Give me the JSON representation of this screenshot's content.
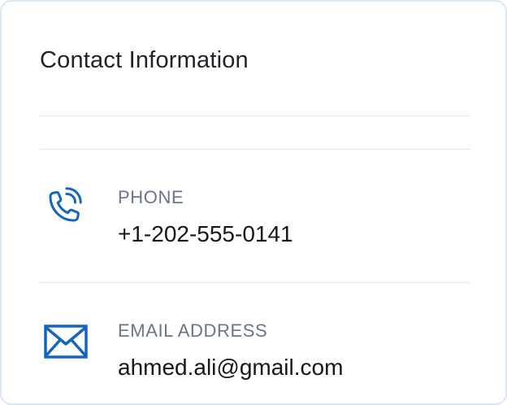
{
  "card": {
    "title": "Contact Information"
  },
  "contacts": [
    {
      "icon": "phone-icon",
      "label": "PHONE",
      "value": "+1-202-555-0141"
    },
    {
      "icon": "mail-icon",
      "label": "EMAIL ADDRESS",
      "value": "ahmed.ali@gmail.com"
    }
  ],
  "colors": {
    "icon_blue": "#1565c0",
    "label_gray": "#6b7585",
    "value_text": "#15181c",
    "border": "#dbe6f3"
  }
}
